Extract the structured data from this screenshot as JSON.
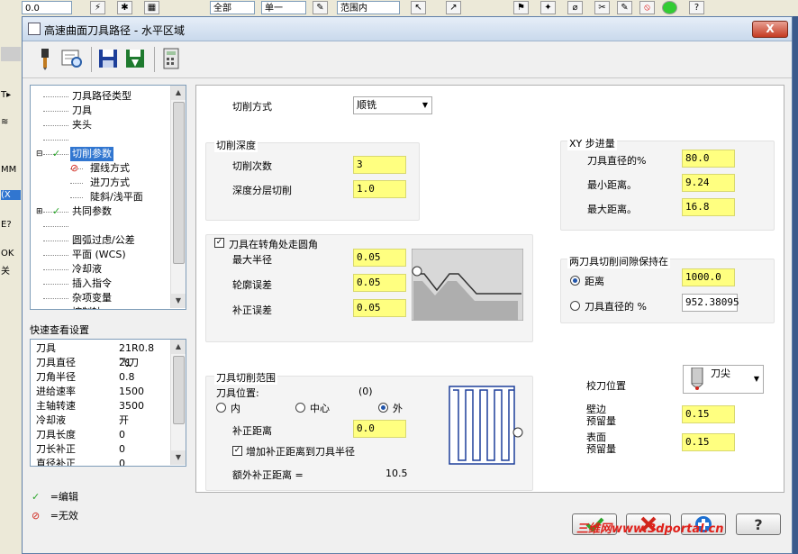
{
  "background_app": {
    "combo_value": "0.0",
    "combo2": "全部",
    "combo3": "单一",
    "combo4": "范围内",
    "left_texts": [
      "MM",
      "(X",
      "E?",
      "OK",
      "关"
    ]
  },
  "dialog": {
    "title": "高速曲面刀具路径 - 水平区域",
    "close_label": "X"
  },
  "tree": {
    "items": [
      {
        "label": "刀具路径类型",
        "indent": 0,
        "icon": ""
      },
      {
        "label": "刀具",
        "indent": 0,
        "icon": ""
      },
      {
        "label": "夹头",
        "indent": 0,
        "icon": ""
      },
      {
        "label": "",
        "indent": 0,
        "icon": ""
      },
      {
        "label": "切削参数",
        "indent": 0,
        "icon": "check",
        "selected": true,
        "expanded": true
      },
      {
        "label": "摆线方式",
        "indent": 1,
        "icon": "invalid"
      },
      {
        "label": "进刀方式",
        "indent": 1,
        "icon": ""
      },
      {
        "label": "陡斜/浅平面",
        "indent": 1,
        "icon": ""
      },
      {
        "label": "共同参数",
        "indent": 0,
        "icon": "check",
        "expandable": true
      },
      {
        "label": "",
        "indent": 0,
        "icon": ""
      },
      {
        "label": "圆弧过虑/公差",
        "indent": 0,
        "icon": ""
      },
      {
        "label": "平面 (WCS)",
        "indent": 0,
        "icon": ""
      },
      {
        "label": "冷却液",
        "indent": 0,
        "icon": ""
      },
      {
        "label": "插入指令",
        "indent": 0,
        "icon": ""
      },
      {
        "label": "杂项变量",
        "indent": 0,
        "icon": ""
      },
      {
        "label": "控制轴",
        "indent": 0,
        "icon": ""
      }
    ]
  },
  "quick_view": {
    "label": "快速查看设置",
    "rows": [
      {
        "key": "刀具",
        "value": "21R0.8飞刀"
      },
      {
        "key": "刀具直径",
        "value": "21"
      },
      {
        "key": "刀角半径",
        "value": "0.8"
      },
      {
        "key": "进给速率",
        "value": "1500"
      },
      {
        "key": "主轴转速",
        "value": "3500"
      },
      {
        "key": "冷却液",
        "value": "开"
      },
      {
        "key": "刀具长度",
        "value": "0"
      },
      {
        "key": "刀长补正",
        "value": "0"
      },
      {
        "key": "直径补正",
        "value": "0"
      }
    ]
  },
  "legend": {
    "edit": "=编辑",
    "invalid": "=无效"
  },
  "params": {
    "cut_method_label": "切削方式",
    "cut_method_value": "顺铣",
    "depth_group": "切削深度",
    "cut_count_label": "切削次数",
    "cut_count_value": "3",
    "depth_step_label": "深度分层切削",
    "depth_step_value": "1.0",
    "corner_check_label": "刀具在转角处走圆角",
    "max_radius_label": "最大半径",
    "max_radius_value": "0.05",
    "profile_tol_label": "轮廓误差",
    "profile_tol_value": "0.05",
    "comp_tol_label": "补正误差",
    "comp_tol_value": "0.05",
    "xy_group": "XY 步进量",
    "tool_dia_pct_label": "刀具直径的%",
    "tool_dia_pct_value": "80.0",
    "min_dist_label": "最小距离。",
    "min_dist_value": "9.24",
    "max_dist_label": "最大距离。",
    "max_dist_value": "16.8",
    "gap_group": "两刀具切削间隙保持在",
    "gap_distance_label": "距离",
    "gap_distance_value": "1000.0",
    "gap_dia_label": "刀具直径的 %",
    "gap_dia_value": "952.38095",
    "range_group": "刀具切削范围",
    "tool_pos_label": "刀具位置:",
    "tool_pos_value": "(0)",
    "pos_inside": "内",
    "pos_center": "中心",
    "pos_outside": "外",
    "offset_dist_label": "补正距离",
    "offset_dist_value": "0.0",
    "add_offset_label": "增加补正距离到刀具半径",
    "extra_offset_label": "额外补正距离 =",
    "extra_offset_value": "10.5",
    "tip_pos_label": "校刀位置",
    "tip_pos_value": "刀尖",
    "wall_stock_label": "壁边\n预留量",
    "wall_stock_value": "0.15",
    "floor_stock_label": "表面\n预留量",
    "floor_stock_value": "0.15"
  },
  "watermark": "三维网www.3dportal.cn",
  "colors": {
    "field_bg": "#ffff80",
    "ok_green": "#2aa52a",
    "cancel_red": "#d0261c",
    "help_blue": "#1d6fd1",
    "selection": "#3176d0"
  }
}
